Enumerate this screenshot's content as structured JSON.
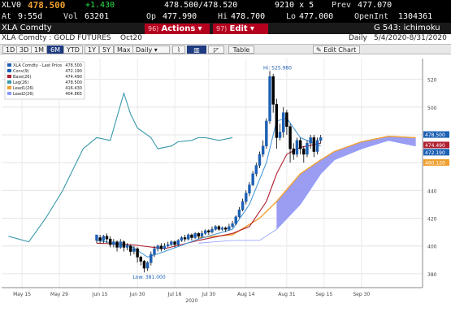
{
  "header": {
    "ticker": "XLV0",
    "last": "478.500",
    "change": "+1.430",
    "bid_ask": "478.500/478.520",
    "size": "9210 x 5",
    "prev_label": "Prev",
    "prev": "477.070",
    "at_label": "At",
    "time": "9:55d",
    "vol_label": "Vol",
    "vol": "63201",
    "op_label": "Op",
    "open": "477.990",
    "hi_label": "Hi",
    "hi": "478.700",
    "lo_label": "Lo",
    "lo": "477.000",
    "oi_label": "OpenInt",
    "oi": "1304361"
  },
  "commandbar": {
    "security": "XLA Comdty",
    "actions_num": "96)",
    "actions": "Actions",
    "edit_num": "97)",
    "edit": "Edit",
    "function": "G 543: ichimoku"
  },
  "subbar": {
    "name": "XLA Comdty : GOLD FUTURES",
    "contract": "Oct20",
    "period": "Daily",
    "range": "5/4/2020-8/31/2020"
  },
  "toolbar": {
    "periods": [
      "1D",
      "3D",
      "1M",
      "6M",
      "YTD",
      "1Y",
      "5Y",
      "Max"
    ],
    "selected": "6M",
    "freq": "Daily",
    "table": "Table",
    "edit_chart": "Edit Chart"
  },
  "legend": [
    {
      "name": "XLA Comdty - Last Price",
      "value": "478.500",
      "color": "#1d60b4"
    },
    {
      "name": "Conv(9)",
      "value": "472.190",
      "color": "#1d60b4"
    },
    {
      "name": "Base(26)",
      "value": "474.490",
      "color": "#b02030"
    },
    {
      "name": "Lag(26)",
      "value": "478.500",
      "color": "#3a9aaa"
    },
    {
      "name": "Lead1(26)",
      "value": "416.430",
      "color": "#f0a030"
    },
    {
      "name": "Lead2(26)",
      "value": "404.865",
      "color": "#8a9aff"
    }
  ],
  "chart_data": {
    "type": "candlestick",
    "ylim": [
      370,
      535
    ],
    "yticks": [
      380,
      400,
      420,
      440,
      460,
      480,
      500,
      520
    ],
    "xticks": [
      "May 15",
      "May 29",
      "Jun 15",
      "Jun 30",
      "Jul 16",
      "Jul 30",
      "Aug 14",
      "Aug 31",
      "Sep 15",
      "Sep 30"
    ],
    "year_label": "2020",
    "high_label": "Hi: 525.980",
    "low_label": "Low: 381.000",
    "right_labels": [
      {
        "value": "478.500",
        "color": "#1d60b4"
      },
      {
        "value": "474.490",
        "color": "#b02030"
      },
      {
        "value": "472.190",
        "color": "#1d60b4"
      },
      {
        "value": "460.120",
        "color": "#f0a030"
      }
    ],
    "candles": [
      [
        0,
        404,
        408,
        402,
        406
      ],
      [
        1,
        406,
        404,
        402,
        408
      ],
      [
        2,
        404,
        407,
        402,
        408
      ],
      [
        3,
        407,
        405,
        402,
        409
      ],
      [
        4,
        405,
        401,
        399,
        407
      ],
      [
        5,
        401,
        403,
        399,
        405
      ],
      [
        6,
        403,
        399,
        396,
        404
      ],
      [
        7,
        399,
        403,
        398,
        405
      ],
      [
        8,
        403,
        399,
        396,
        404
      ],
      [
        9,
        399,
        400,
        397,
        402
      ],
      [
        10,
        400,
        396,
        393,
        401
      ],
      [
        11,
        396,
        398,
        394,
        400
      ],
      [
        12,
        398,
        392,
        388,
        399
      ],
      [
        13,
        392,
        389,
        386,
        393
      ],
      [
        14,
        389,
        384,
        381,
        390
      ],
      [
        15,
        384,
        388,
        382,
        389
      ],
      [
        16,
        388,
        394,
        386,
        396
      ],
      [
        17,
        394,
        398,
        392,
        400
      ],
      [
        18,
        398,
        400,
        396,
        401
      ],
      [
        19,
        400,
        398,
        396,
        402
      ],
      [
        20,
        398,
        400,
        397,
        402
      ],
      [
        21,
        400,
        401,
        399,
        403
      ],
      [
        22,
        401,
        403,
        400,
        404
      ],
      [
        23,
        403,
        401,
        399,
        404
      ],
      [
        24,
        401,
        404,
        400,
        405
      ],
      [
        25,
        404,
        406,
        403,
        407
      ],
      [
        26,
        406,
        405,
        403,
        408
      ],
      [
        27,
        405,
        408,
        404,
        409
      ],
      [
        28,
        408,
        406,
        404,
        409
      ],
      [
        29,
        406,
        409,
        405,
        410
      ],
      [
        30,
        409,
        407,
        405,
        410
      ],
      [
        31,
        407,
        409,
        406,
        411
      ],
      [
        32,
        409,
        411,
        408,
        412
      ],
      [
        33,
        411,
        410,
        408,
        412
      ],
      [
        34,
        410,
        412,
        409,
        414
      ],
      [
        35,
        412,
        414,
        411,
        415
      ],
      [
        36,
        414,
        412,
        411,
        415
      ],
      [
        37,
        412,
        413,
        411,
        414
      ],
      [
        38,
        413,
        412,
        410,
        414
      ],
      [
        39,
        412,
        414,
        411,
        416
      ],
      [
        40,
        414,
        416,
        413,
        418
      ],
      [
        41,
        416,
        421,
        415,
        422
      ],
      [
        42,
        421,
        426,
        420,
        428
      ],
      [
        43,
        426,
        432,
        425,
        434
      ],
      [
        44,
        432,
        438,
        430,
        440
      ],
      [
        45,
        438,
        444,
        436,
        446
      ],
      [
        46,
        444,
        452,
        443,
        454
      ],
      [
        47,
        452,
        458,
        450,
        460
      ],
      [
        48,
        458,
        466,
        456,
        468
      ],
      [
        49,
        466,
        472,
        464,
        476
      ],
      [
        50,
        472,
        490,
        470,
        492
      ],
      [
        51,
        490,
        522,
        488,
        526
      ],
      [
        52,
        522,
        502,
        496,
        524
      ],
      [
        53,
        502,
        478,
        470,
        506
      ],
      [
        54,
        478,
        482,
        476,
        488
      ],
      [
        55,
        482,
        496,
        478,
        500
      ],
      [
        56,
        496,
        486,
        480,
        498
      ],
      [
        57,
        486,
        470,
        460,
        488
      ],
      [
        58,
        470,
        466,
        462,
        474
      ],
      [
        59,
        466,
        476,
        464,
        478
      ],
      [
        60,
        476,
        470,
        466,
        478
      ],
      [
        61,
        470,
        466,
        460,
        472
      ],
      [
        62,
        466,
        474,
        464,
        476
      ],
      [
        63,
        474,
        478,
        470,
        480
      ],
      [
        64,
        478,
        468,
        464,
        480
      ],
      [
        65,
        468,
        476,
        466,
        478
      ],
      [
        66,
        476,
        478,
        474,
        480
      ]
    ],
    "conv": [
      [
        0,
        404
      ],
      [
        10,
        400
      ],
      [
        15,
        392
      ],
      [
        20,
        396
      ],
      [
        30,
        405
      ],
      [
        40,
        412
      ],
      [
        45,
        430
      ],
      [
        50,
        460
      ],
      [
        53,
        490
      ],
      [
        56,
        492
      ],
      [
        60,
        478
      ],
      [
        66,
        472
      ]
    ],
    "base": [
      [
        0,
        402
      ],
      [
        10,
        401
      ],
      [
        20,
        398
      ],
      [
        30,
        404
      ],
      [
        40,
        409
      ],
      [
        45,
        414
      ],
      [
        50,
        432
      ],
      [
        53,
        452
      ],
      [
        56,
        466
      ],
      [
        60,
        471
      ],
      [
        66,
        474
      ]
    ],
    "lag": [
      [
        -26,
        407
      ],
      [
        -20,
        403
      ],
      [
        -15,
        420
      ],
      [
        -10,
        440
      ],
      [
        -8,
        450
      ],
      [
        -4,
        470
      ],
      [
        0,
        478
      ],
      [
        4,
        476
      ],
      [
        8,
        510
      ],
      [
        10,
        495
      ],
      [
        12,
        485
      ],
      [
        16,
        478
      ],
      [
        18,
        470
      ],
      [
        22,
        472
      ],
      [
        24,
        475
      ],
      [
        28,
        476
      ],
      [
        30,
        478
      ],
      [
        32,
        478
      ],
      [
        36,
        476
      ],
      [
        40,
        478
      ]
    ],
    "lead1": [
      [
        30,
        406
      ],
      [
        40,
        408
      ],
      [
        48,
        420
      ],
      [
        53,
        432
      ],
      [
        60,
        452
      ],
      [
        66,
        462
      ],
      [
        70,
        468
      ],
      [
        78,
        475
      ],
      [
        86,
        479
      ],
      [
        94,
        478
      ]
    ],
    "lead2": [
      [
        30,
        402
      ],
      [
        40,
        404
      ],
      [
        48,
        404
      ],
      [
        53,
        412
      ],
      [
        60,
        430
      ],
      [
        66,
        452
      ],
      [
        70,
        462
      ],
      [
        78,
        470
      ],
      [
        86,
        476
      ],
      [
        94,
        472
      ]
    ]
  }
}
